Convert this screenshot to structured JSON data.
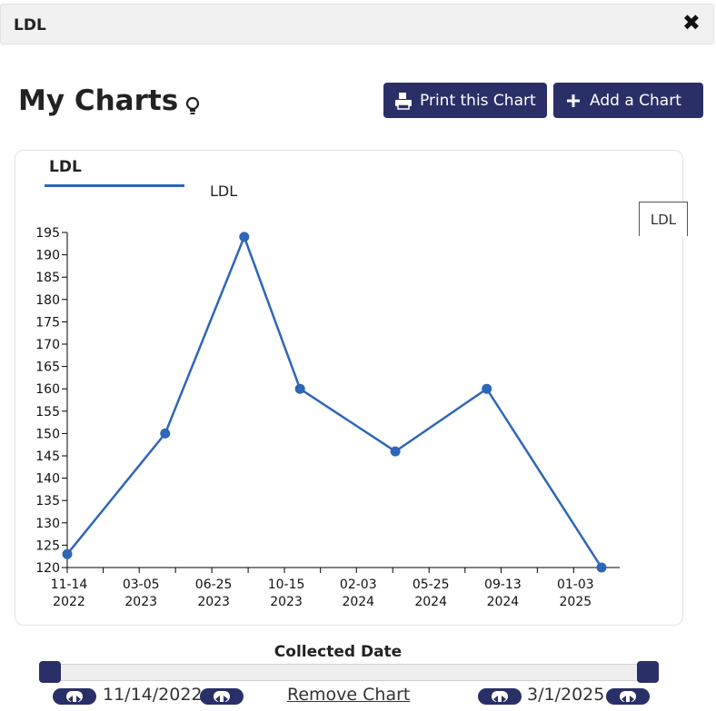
{
  "window": {
    "title": "LDL",
    "close_icon": "close-icon"
  },
  "header": {
    "title": "My Charts",
    "bulb_icon": "lightbulb-icon",
    "print_label": "Print this Chart",
    "add_label": "Add a Chart"
  },
  "chart_panel": {
    "tab_label": "LDL",
    "legend_label": "LDL",
    "side_legend_label": "LDL",
    "x_axis_title": "Collected Date"
  },
  "range": {
    "start_date": "11/14/2022",
    "end_date": "3/1/2025",
    "remove_label": "Remove Chart"
  },
  "colors": {
    "series": "#2e66b8",
    "button": "#2a2f68"
  },
  "chart_data": {
    "type": "line",
    "title": "",
    "xlabel": "Collected Date",
    "ylabel": "",
    "ylim": [
      120,
      195
    ],
    "y_ticks": [
      120,
      125,
      130,
      135,
      140,
      145,
      150,
      155,
      160,
      165,
      170,
      175,
      180,
      185,
      190,
      195
    ],
    "x_range": [
      "2022-11-14",
      "2025-03-01"
    ],
    "x_ticks": [
      {
        "date": "2022-11-14",
        "line1": "11-14",
        "line2": "2022"
      },
      {
        "date": "2023-03-05",
        "line1": "03-05",
        "line2": "2023"
      },
      {
        "date": "2023-06-25",
        "line1": "06-25",
        "line2": "2023"
      },
      {
        "date": "2023-10-15",
        "line1": "10-15",
        "line2": "2023"
      },
      {
        "date": "2024-02-03",
        "line1": "02-03",
        "line2": "2024"
      },
      {
        "date": "2024-05-25",
        "line1": "05-25",
        "line2": "2024"
      },
      {
        "date": "2024-09-13",
        "line1": "09-13",
        "line2": "2024"
      },
      {
        "date": "2025-01-03",
        "line1": "01-03",
        "line2": "2025"
      }
    ],
    "series": [
      {
        "name": "LDL",
        "points": [
          {
            "x": "2022-11-14",
            "y": 123
          },
          {
            "x": "2023-04-14",
            "y": 150
          },
          {
            "x": "2023-08-14",
            "y": 194
          },
          {
            "x": "2023-11-08",
            "y": 160
          },
          {
            "x": "2024-04-03",
            "y": 146
          },
          {
            "x": "2024-08-22",
            "y": 160
          },
          {
            "x": "2025-02-15",
            "y": 120
          }
        ]
      }
    ]
  }
}
